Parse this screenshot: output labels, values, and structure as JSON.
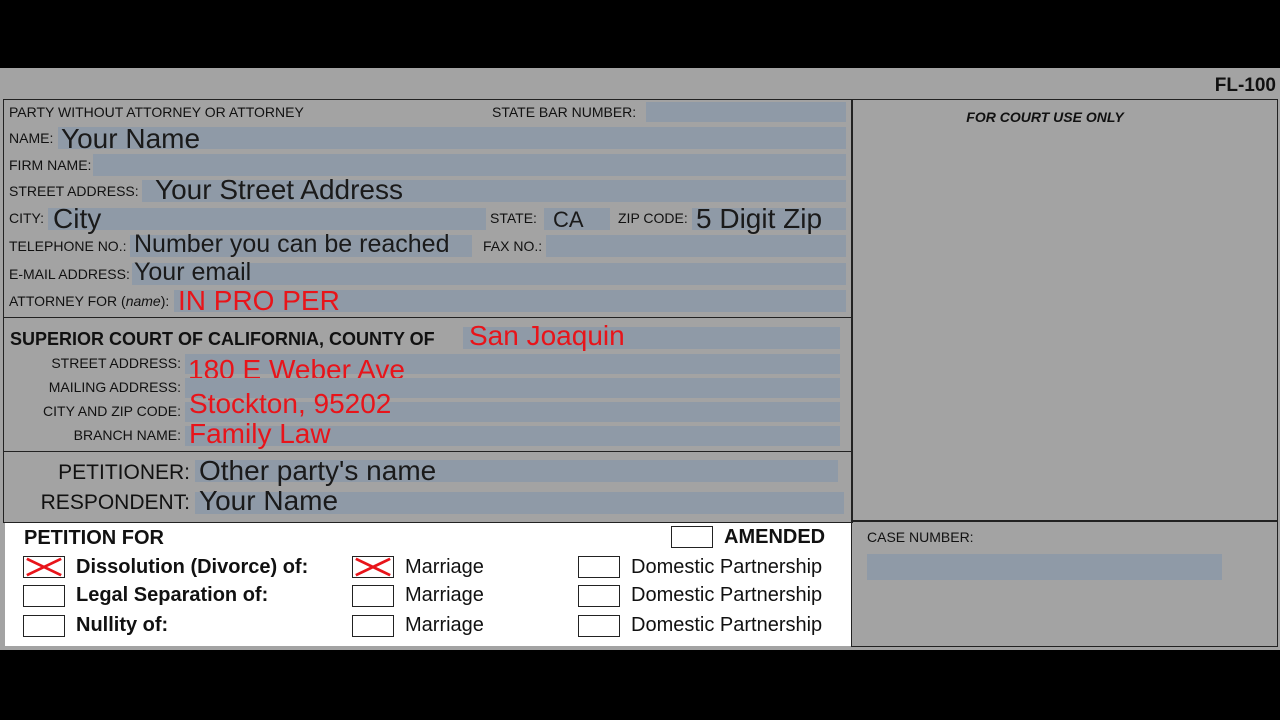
{
  "form_id": "FL-100",
  "header": {
    "party_label": "PARTY WITHOUT ATTORNEY OR ATTORNEY",
    "state_bar_label": "STATE BAR NUMBER:",
    "name_label": "NAME:",
    "name_value": "Your Name",
    "firm_label": "FIRM NAME:",
    "street_label": "STREET ADDRESS:",
    "street_value": "Your Street Address",
    "city_label": "CITY:",
    "city_value": "City",
    "state_label": "STATE:",
    "state_value": "CA",
    "zip_label": "ZIP CODE:",
    "zip_value": "5 Digit Zip",
    "phone_label": "TELEPHONE NO.:",
    "phone_value": "Number you can be reached",
    "fax_label": "FAX NO.:",
    "email_label": "E-MAIL ADDRESS:",
    "email_value": "Your email",
    "attorney_label_pre": "ATTORNEY FOR (",
    "attorney_label_em": "name",
    "attorney_label_post": "):",
    "attorney_value": "IN PRO PER"
  },
  "court_use": {
    "label": "FOR COURT USE ONLY",
    "case_number_label": "CASE NUMBER:"
  },
  "court": {
    "title": "SUPERIOR COURT OF CALIFORNIA, COUNTY OF",
    "county_value": "San Joaquin",
    "street_label": "STREET ADDRESS:",
    "street_value": "180 E Weber Ave",
    "mailing_label": "MAILING ADDRESS:",
    "city_zip_label": "CITY AND ZIP CODE:",
    "city_zip_value": "Stockton, 95202",
    "branch_label": "BRANCH NAME:",
    "branch_value": "Family Law"
  },
  "parties": {
    "petitioner_label": "PETITIONER:",
    "petitioner_value": "Other party's name",
    "respondent_label": "RESPONDENT:",
    "respondent_value": "Your Name"
  },
  "petition": {
    "title": "PETITION FOR",
    "amended_label": "AMENDED",
    "rows": [
      {
        "label": "Dissolution (Divorce) of:",
        "checked": true,
        "marriage_checked": true,
        "partnership_checked": false
      },
      {
        "label": "Legal Separation of:",
        "checked": false,
        "marriage_checked": false,
        "partnership_checked": false
      },
      {
        "label": "Nullity of:",
        "checked": false,
        "marriage_checked": false,
        "partnership_checked": false
      }
    ],
    "marriage_label": "Marriage",
    "partnership_label": "Domestic Partnership"
  },
  "colors": {
    "field_fill": "#8f9aa7",
    "red_text": "#e8141a",
    "page_bg": "#a3a3a3"
  }
}
